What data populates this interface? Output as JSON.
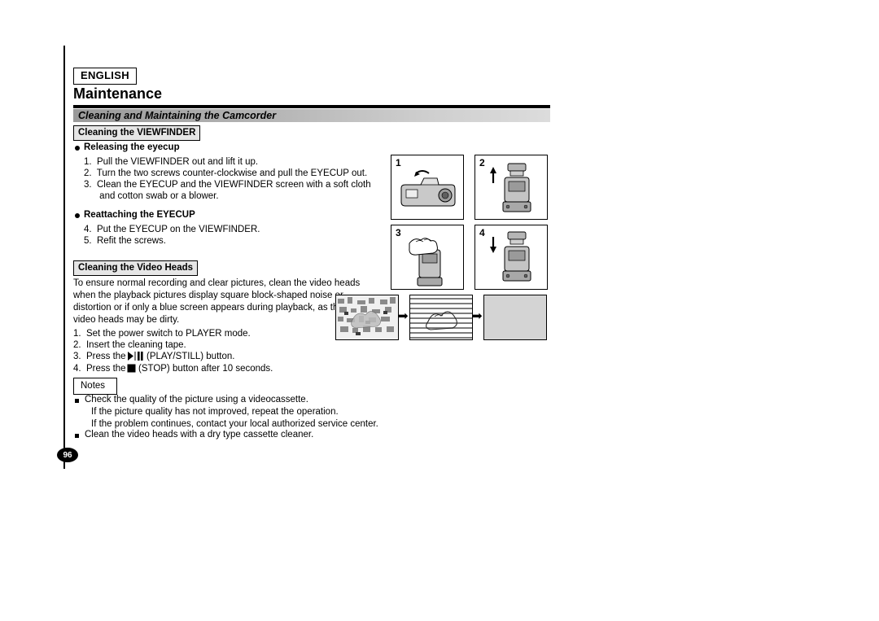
{
  "document": {
    "language_badge": "ENGLISH",
    "chapter_title": "Maintenance",
    "section_title": "Cleaning and Maintaining the Camcorder",
    "page_number": "96"
  },
  "viewfinder": {
    "label": "Cleaning the VIEWFINDER",
    "sub1_title": "Releasing the eyecup",
    "sub1_steps": [
      "1.  Pull the VIEWFINDER out and lift it up.",
      "2.  Turn the two screws counter-clockwise and pull the EYECUP out.",
      "3.  Clean the EYECUP and the VIEWFINDER screen with a soft cloth",
      "      and cotton swab or a blower."
    ],
    "sub2_title": "Reattaching the EYECUP",
    "sub2_steps": [
      "4.  Put the EYECUP on the VIEWFINDER.",
      "5.  Refit the screws."
    ],
    "figure_numbers": [
      "1",
      "2",
      "3",
      "4"
    ]
  },
  "video_heads": {
    "label": "Cleaning the Video Heads",
    "paragraph": [
      "To ensure normal recording and clear pictures, clean the video heads",
      "when the playback pictures display square block-shaped noise or",
      "distortion or if only a blue screen appears during playback, as the",
      "video heads may be dirty."
    ],
    "steps": [
      "1.  Set the power switch to PLAYER mode.",
      "2.  Insert the cleaning tape.",
      "3.  Press the",
      "4.  Press the"
    ],
    "step3_suffix": "(PLAY/STILL) button.",
    "step4_suffix": "(STOP) button after 10 seconds."
  },
  "notes": {
    "label": "Notes",
    "items": [
      [
        "Check the quality of the picture using a videocassette.",
        "If the picture quality has not improved, repeat the operation.",
        "If the problem continues, contact your local authorized service center."
      ],
      [
        "Clean the video heads with a dry type cassette cleaner."
      ]
    ]
  },
  "icons": {
    "arrow_right": "➡"
  },
  "colors": {
    "section_bar_start": "#9a9a9a",
    "section_bar_end": "#dcdcdc",
    "boxed_label_bg": "#e6e6e6",
    "figure_gray": "#d4d4d4"
  }
}
